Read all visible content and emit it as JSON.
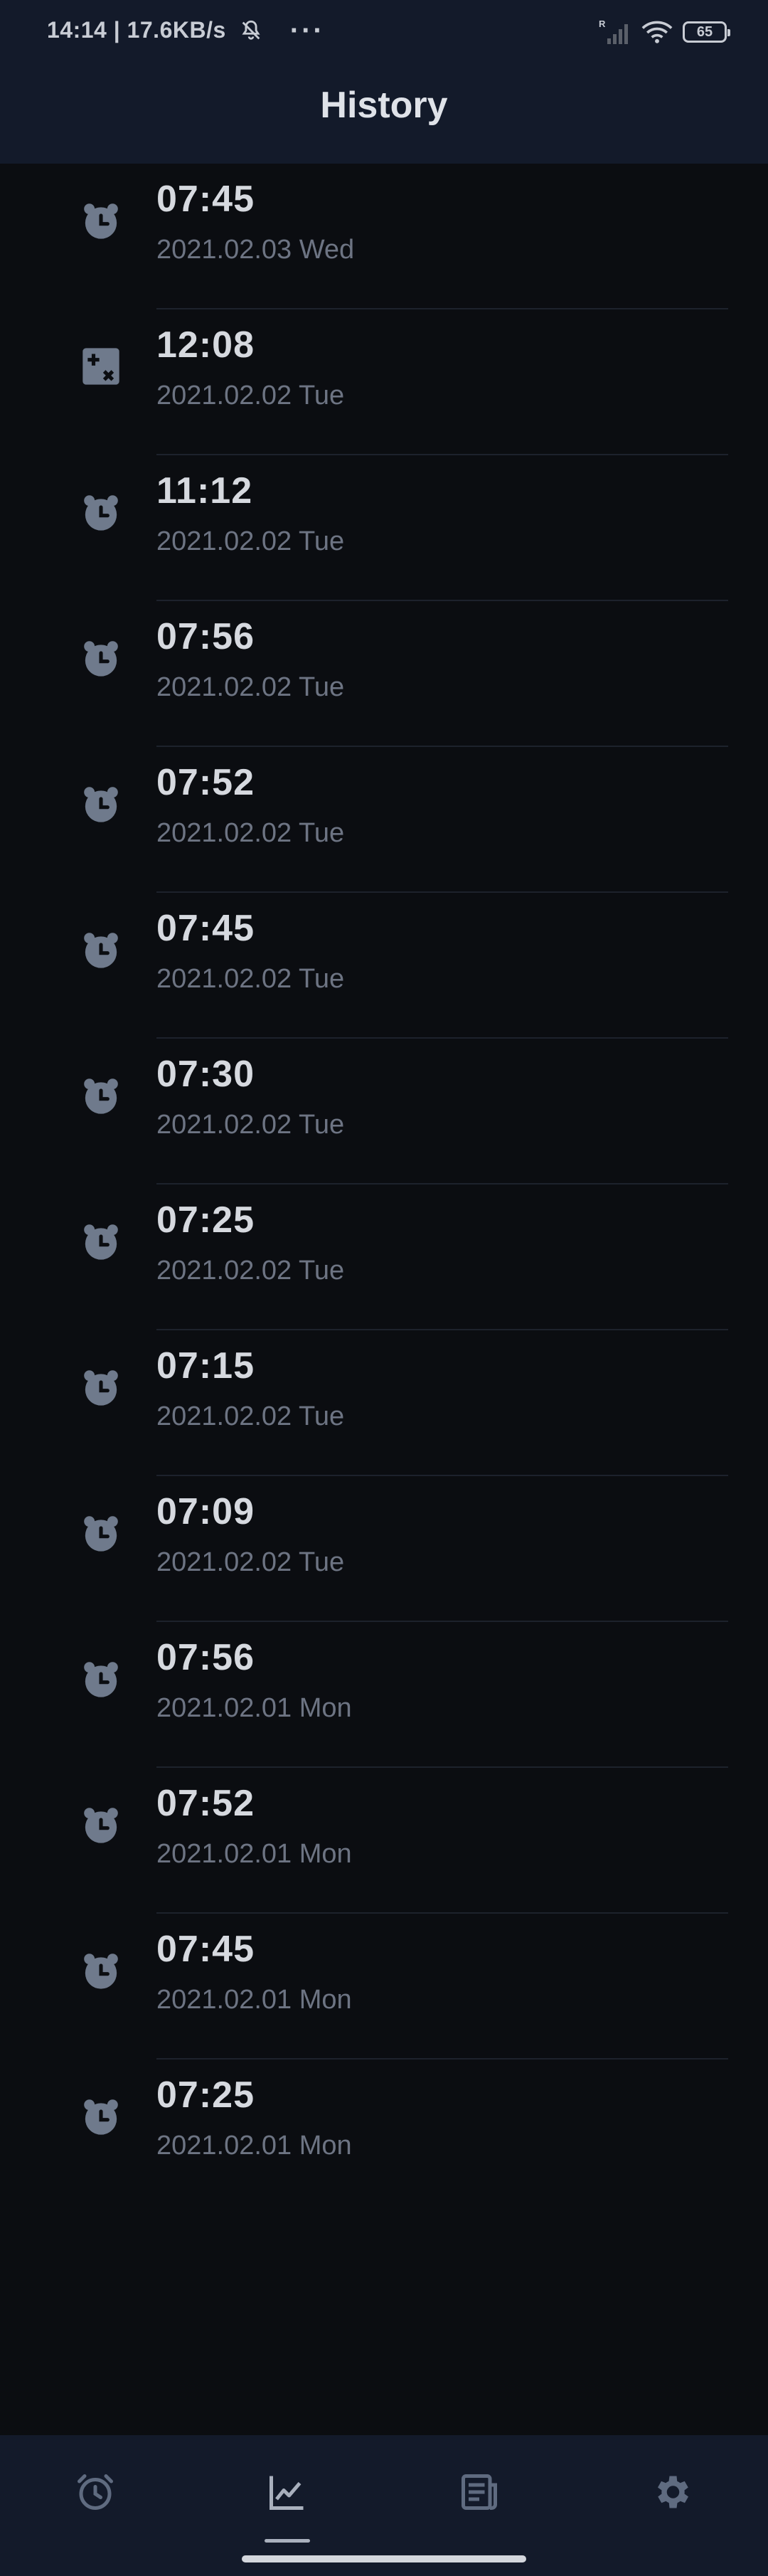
{
  "status_bar": {
    "time_speed": "14:14 | 17.6KB/s",
    "dots": "···",
    "network_r": "R",
    "battery": "65"
  },
  "header": {
    "title": "History"
  },
  "history": [
    {
      "time": "07:45",
      "date": "2021.02.03 Wed",
      "icon": "alarm-clock-icon"
    },
    {
      "time": "12:08",
      "date": "2021.02.02 Tue",
      "icon": "calculator-icon"
    },
    {
      "time": "11:12",
      "date": "2021.02.02 Tue",
      "icon": "alarm-clock-icon"
    },
    {
      "time": "07:56",
      "date": "2021.02.02 Tue",
      "icon": "alarm-clock-icon"
    },
    {
      "time": "07:52",
      "date": "2021.02.02 Tue",
      "icon": "alarm-clock-icon"
    },
    {
      "time": "07:45",
      "date": "2021.02.02 Tue",
      "icon": "alarm-clock-icon"
    },
    {
      "time": "07:30",
      "date": "2021.02.02 Tue",
      "icon": "alarm-clock-icon"
    },
    {
      "time": "07:25",
      "date": "2021.02.02 Tue",
      "icon": "alarm-clock-icon"
    },
    {
      "time": "07:15",
      "date": "2021.02.02 Tue",
      "icon": "alarm-clock-icon"
    },
    {
      "time": "07:09",
      "date": "2021.02.02 Tue",
      "icon": "alarm-clock-icon"
    },
    {
      "time": "07:56",
      "date": "2021.02.01 Mon",
      "icon": "alarm-clock-icon"
    },
    {
      "time": "07:52",
      "date": "2021.02.01 Mon",
      "icon": "alarm-clock-icon"
    },
    {
      "time": "07:45",
      "date": "2021.02.01 Mon",
      "icon": "alarm-clock-icon"
    },
    {
      "time": "07:25",
      "date": "2021.02.01 Mon",
      "icon": "alarm-clock-icon"
    }
  ],
  "bottom_nav": [
    {
      "icon": "alarm-icon",
      "selected": false
    },
    {
      "icon": "chart-icon",
      "selected": true
    },
    {
      "icon": "news-icon",
      "selected": false
    },
    {
      "icon": "settings-icon",
      "selected": false
    }
  ],
  "colors": {
    "bar_bg": "#131a2a",
    "page_bg": "#0b0d11",
    "icon": "#6f7a8c",
    "time_text": "#d6d9df",
    "date_text": "#6d7483"
  }
}
